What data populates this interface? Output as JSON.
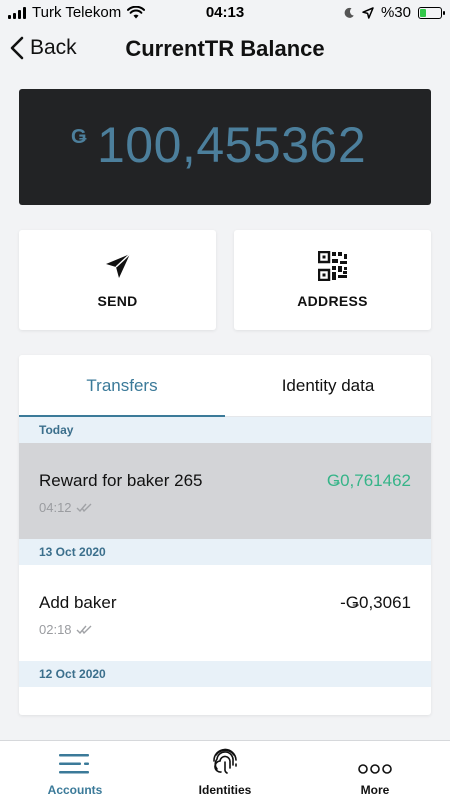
{
  "status_bar": {
    "carrier": "Turk Telekom",
    "time": "04:13",
    "battery_percent": "%30",
    "battery_level": 0.3
  },
  "header": {
    "back_label": "Back",
    "title": "CurrentTR Balance"
  },
  "balance": {
    "currency_symbol": "Ǥ",
    "value": "100,455362",
    "color": "#4c7f9c"
  },
  "actions": {
    "send_label": "SEND",
    "address_label": "ADDRESS"
  },
  "tabs": {
    "transfers_label": "Transfers",
    "identity_label": "Identity data",
    "active": "Transfers"
  },
  "transfers": {
    "group1_date": "Today",
    "tx1": {
      "title": "Reward for baker 265",
      "amount": "Ǥ0,761462",
      "time": "04:12"
    },
    "group2_date": "13 Oct 2020",
    "tx2": {
      "title": "Add baker",
      "amount": "-Ǥ0,3061",
      "time": "02:18"
    },
    "group3_date": "12 Oct 2020"
  },
  "bottom_nav": {
    "accounts_label": "Accounts",
    "identities_label": "Identities",
    "more_label": "More",
    "active": "Accounts"
  },
  "colors": {
    "accent": "#3b7a99",
    "positive": "#35b488",
    "card_dark": "#222325"
  }
}
